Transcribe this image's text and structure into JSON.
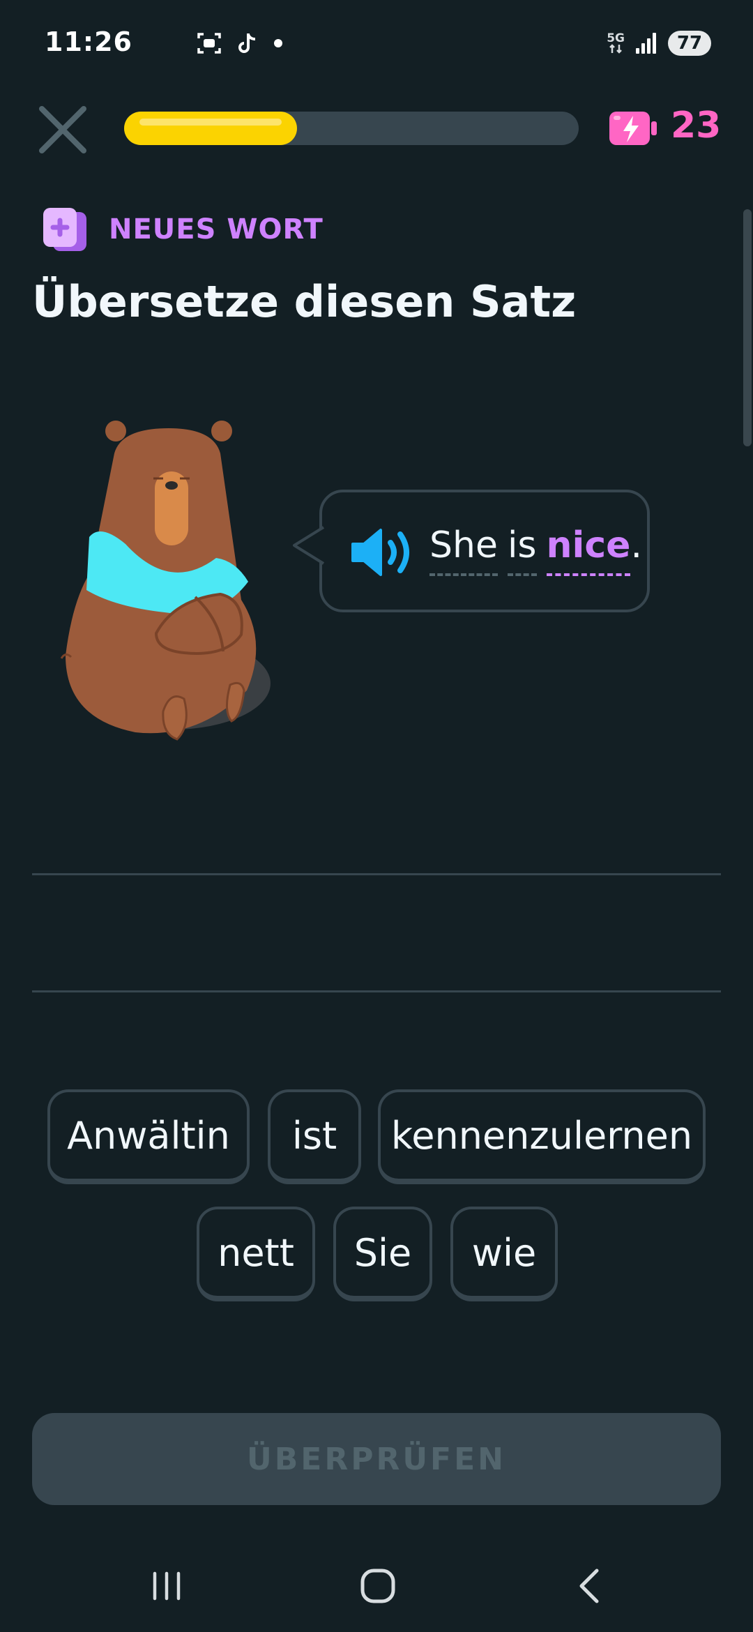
{
  "status_bar": {
    "time": "11:26",
    "network_label": "5G",
    "battery": "77",
    "left_icons": [
      "screen-record-icon",
      "tiktok-icon",
      "notification-dot-icon"
    ],
    "right_icons": [
      "network-5g-icon",
      "signal-icon",
      "battery-icon"
    ]
  },
  "header": {
    "progress_fraction": 0.38,
    "energy_count": "23"
  },
  "lesson": {
    "badge": "NEUES WORT",
    "title": "Übersetze diesen Satz",
    "sentence_words": [
      "She",
      "is",
      "nice"
    ],
    "sentence_end": ".",
    "new_word": "nice"
  },
  "word_bank": {
    "row1": [
      "Anwältin",
      "ist",
      "kennenzulernen"
    ],
    "row2": [
      "nett",
      "Sie",
      "wie"
    ]
  },
  "check_button": "ÜBERPRÜFEN",
  "colors": {
    "background": "#131f24",
    "progress": "#fbd301",
    "energy": "#ff66c4",
    "new_word": "#ce82ff",
    "speaker": "#1cb0f6",
    "border": "#37464f"
  },
  "nav_icons": [
    "recent-apps-icon",
    "home-icon",
    "back-icon"
  ]
}
